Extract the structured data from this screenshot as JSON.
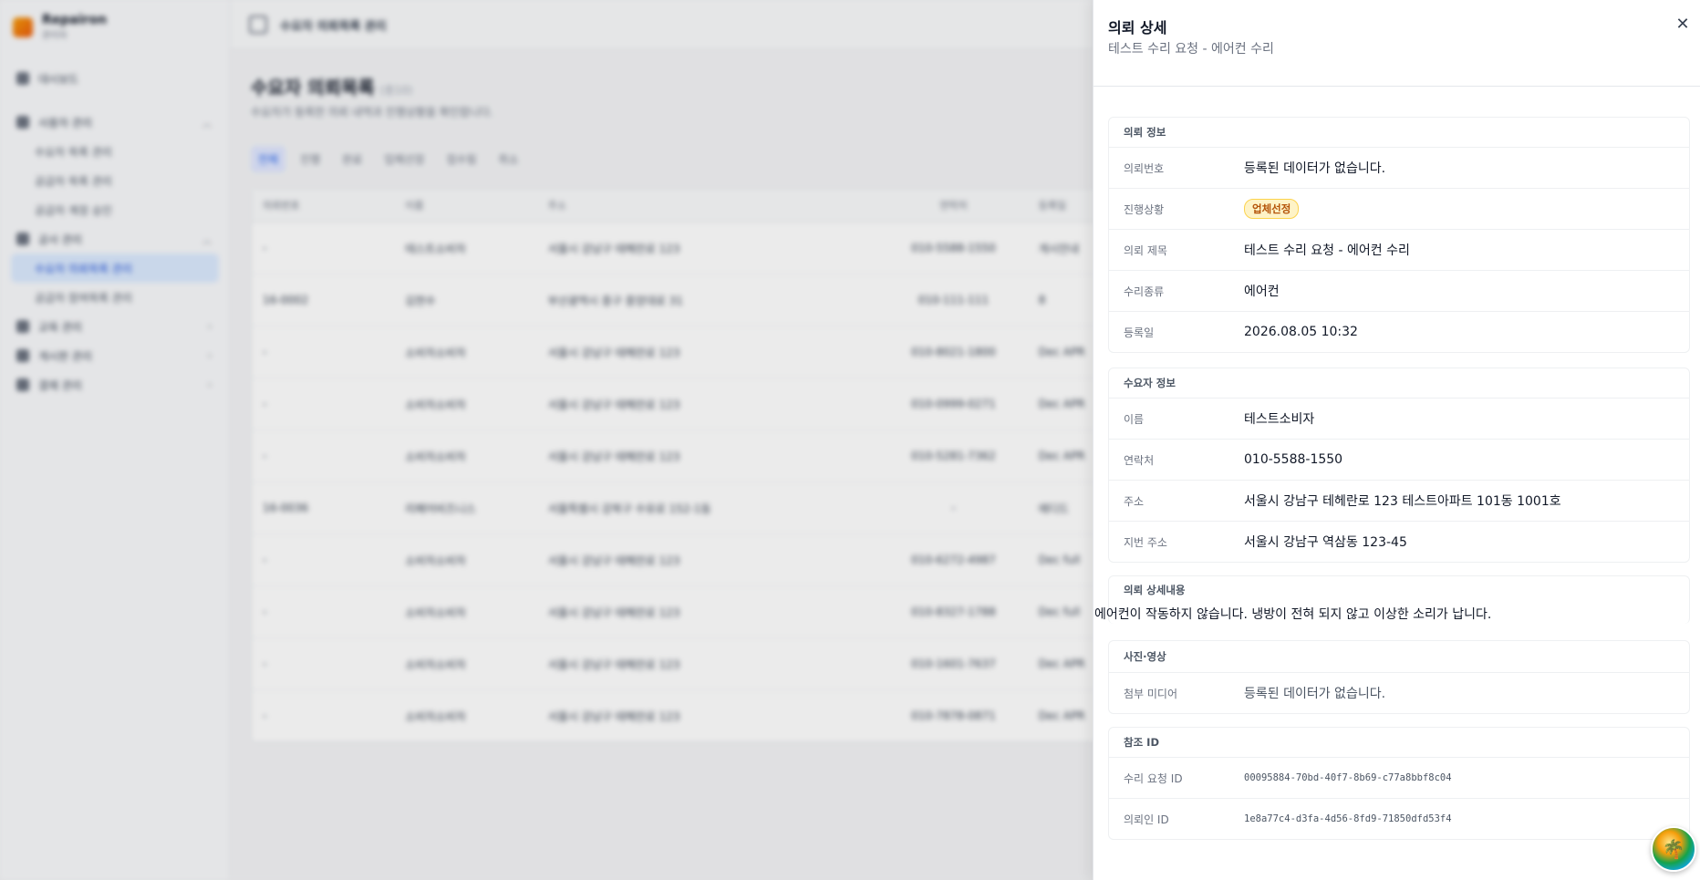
{
  "app": {
    "brand_name": "Repairon",
    "brand_sub": "관리자",
    "topbar_title": "수요자 의뢰목록 관리"
  },
  "sidebar": {
    "items": [
      {
        "label": "대시보드"
      },
      {
        "label": "사용자 관리"
      },
      {
        "label": "수요자 목록 관리"
      },
      {
        "label": "공급자 목록 관리"
      },
      {
        "label": "공급자 계정 승인"
      },
      {
        "label": "공사 관리"
      },
      {
        "label": "수요자 의뢰목록 관리"
      },
      {
        "label": "공급자 참여목록 관리"
      },
      {
        "label": "교육 관리"
      },
      {
        "label": "게시판 관리"
      },
      {
        "label": "결제 관리"
      }
    ]
  },
  "main": {
    "title": "수요자 의뢰목록",
    "title_count": "(총10)",
    "description": "수요자가 등록한 의뢰 내역과 진행상황을 확인합니다.",
    "tabs": [
      "전체",
      "진행",
      "완료",
      "업체선정",
      "접수됨",
      "취소"
    ],
    "table": {
      "headers": [
        "의뢰번호",
        "이름",
        "주소",
        "연락처",
        "등록일"
      ],
      "rows": [
        [
          "-",
          "테스트소비자",
          "서울시 강남구 테헤란로 123",
          "010-5588-1550",
          "게시안내"
        ],
        [
          "16-0002",
          "김현수",
          "부산광역시 중구 중앙대로 31",
          "010-111-111",
          "8"
        ],
        [
          "-",
          "소비자소비자",
          "서울시 강남구 테헤란로 123",
          "010-8021-1800",
          "Dec APR"
        ],
        [
          "-",
          "소비자소비자",
          "서울시 강남구 테헤란로 123",
          "010-0999-0271",
          "Dec APR"
        ],
        [
          "-",
          "소비자소비자",
          "서울시 강남구 테헤란로 123",
          "010-5281-7362",
          "Dec APR"
        ],
        [
          "16-0036",
          "리페어비즈니스",
          "서울특별시 강북구 수유로 152-1동",
          "-",
          "에디드"
        ],
        [
          "-",
          "소비자소비자",
          "서울시 강남구 테헤란로 123",
          "010-6272-4987",
          "Dec full"
        ],
        [
          "-",
          "소비자소비자",
          "서울시 강남구 테헤란로 123",
          "010-8327-1788",
          "Dec full"
        ],
        [
          "-",
          "소비자소비자",
          "서울시 강남구 테헤란로 123",
          "010-1601-7637",
          "Dec APR"
        ],
        [
          "-",
          "소비자소비자",
          "서울시 강남구 테헤란로 123",
          "010-7878-0871",
          "Dec APR"
        ]
      ]
    }
  },
  "drawer": {
    "title": "의뢰 상세",
    "subtitle": "테스트 수리 요청 - 에어컨 수리",
    "close_label": "✕",
    "request_info": {
      "heading": "의뢰 정보",
      "rows": [
        {
          "key": "의뢰번호",
          "value": "등록된 데이터가 없습니다."
        },
        {
          "key": "진행상황",
          "value": "업체선정"
        },
        {
          "key": "의뢰 제목",
          "value": "테스트 수리 요청 - 에어컨 수리"
        },
        {
          "key": "수리종류",
          "value": "에어컨"
        },
        {
          "key": "등록일",
          "value": "2026.08.05 10:32"
        }
      ]
    },
    "customer_info": {
      "heading": "수요자 정보",
      "rows": [
        {
          "key": "이름",
          "value": "테스트소비자"
        },
        {
          "key": "연락처",
          "value": "010-5588-1550"
        },
        {
          "key": "주소",
          "value": "서울시 강남구 테헤란로 123 테스트아파트 101동 1001호"
        },
        {
          "key": "지번 주소",
          "value": "서울시 강남구 역삼동 123-45"
        }
      ]
    },
    "detail": {
      "heading": "의뢰 상세내용",
      "text": "에어컨이 작동하지 않습니다. 냉방이 전혀 되지 않고 이상한 소리가 납니다."
    },
    "media": {
      "heading": "사진·영상",
      "rows": [
        {
          "key": "첨부 미디어",
          "value": "등록된 데이터가 없습니다."
        }
      ]
    },
    "reference": {
      "heading": "참조 ID",
      "rows": [
        {
          "key": "수리 요청 ID",
          "value": "00095884-70bd-40f7-8b69-c77a8bbf8c04"
        },
        {
          "key": "의뢰인 ID",
          "value": "1e8a77c4-d3fa-4d56-8fd9-71850dfd53f4"
        }
      ]
    }
  },
  "colors": {
    "badge_bg": "#fef3c7",
    "badge_text": "#b45309",
    "active_tab": "#2563eb"
  }
}
